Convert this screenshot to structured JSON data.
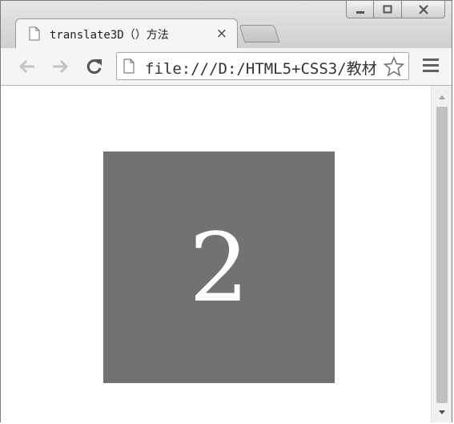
{
  "window": {
    "controls": [
      "minimize-icon",
      "maximize-icon",
      "close-icon"
    ]
  },
  "tab": {
    "title": "translate3D（）方法",
    "icon": "document-icon",
    "close_label": "×"
  },
  "toolbar": {
    "back_icon": "arrow-left-icon",
    "forward_icon": "arrow-right-icon",
    "reload_icon": "reload-icon"
  },
  "address": {
    "url": "file:///D:/HTML5+CSS3/教材",
    "icon": "document-icon",
    "bookmark_icon": "star-icon"
  },
  "menu": {
    "icon": "hamburger-menu-icon"
  },
  "content": {
    "box_label": "2",
    "box_color": "#727272"
  },
  "scrollbar": {
    "up_icon": "triangle-up-icon",
    "down_icon": "triangle-down-icon"
  }
}
